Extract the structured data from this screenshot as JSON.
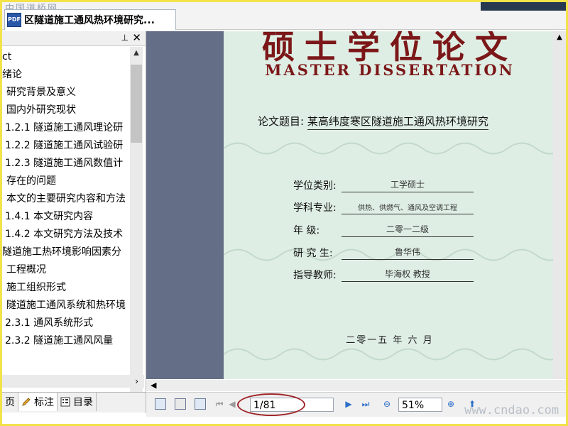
{
  "window": {
    "doc_tab_title": "区隧道施工通风热环境研究...",
    "app_icon_text": "PDF",
    "watermark_top": "中国道桥网",
    "watermark_bottom": "www.cndao.com"
  },
  "panel": {
    "pin_icon": "pin-icon",
    "close_icon": "close-icon",
    "toc_items": [
      "ct",
      "绪论",
      "研究背景及意义",
      "国内外研究现状",
      "1.2.1 隧道施工通风理论研",
      "1.2.2 隧道施工通风试验研",
      "1.2.3 隧道施工通风数值计",
      "存在的问题",
      "本文的主要研究内容和方法",
      "1.4.1 本文研究内容",
      "1.4.2 本文研究方法及技术",
      "隧道施工热环境影响因素分",
      "工程概况",
      "施工组织形式",
      "隧道施工通风系统和热环境",
      "2.3.1 通风系统形式",
      "2.3.2 隧道施工通风风量"
    ],
    "tabs": [
      {
        "label": "页",
        "icon": "page-icon"
      },
      {
        "label": "标注",
        "icon": "pencil-icon"
      },
      {
        "label": "目录",
        "icon": "outline-icon"
      }
    ]
  },
  "page": {
    "title_cn": "硕士学位论文",
    "title_en": "MASTER   DISSERTATION",
    "thesis_label": "论文题目:",
    "thesis_value": "某高纬度寒区隧道施工通风热环境研究",
    "fields": [
      {
        "label": "学位类别:",
        "value": "工学硕士"
      },
      {
        "label": "学科专业:",
        "value": "供热、供燃气、通风及空调工程"
      },
      {
        "label": "年    级:",
        "value": "二零一二级"
      },
      {
        "label": "研 究 生:",
        "value": "鲁华伟"
      },
      {
        "label": "指导教师:",
        "value": "毕海权 教授"
      }
    ],
    "date": "二零一五 年 六 月"
  },
  "toolbar": {
    "page_value": "1/81",
    "zoom_value": "51%",
    "highlight_color": "#a0262a"
  }
}
